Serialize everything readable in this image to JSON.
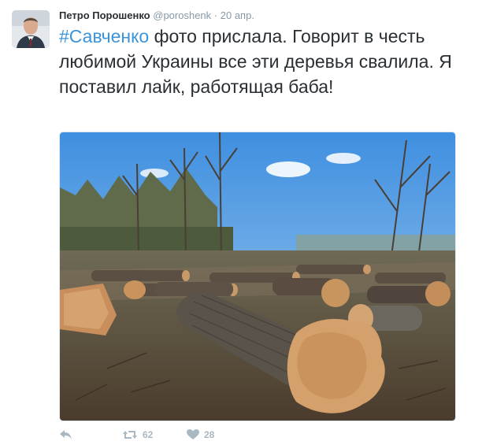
{
  "tweet": {
    "author_name": "Петро Порошенко",
    "handle": "@poroshenk",
    "separator": "·",
    "timestamp": "20 апр.",
    "hashtag": "#Савченко",
    "text_rest": " фото прислала. Говорит в честь любимой Украины все эти деревья свалила. Я поставил лайк, работящая баба!",
    "media_description_icon": "photo-of-felled-logs",
    "actions": {
      "reply_icon": "reply-icon",
      "retweet_icon": "retweet-icon",
      "retweet_count": "62",
      "like_icon": "heart-icon",
      "like_count": "28"
    },
    "colors": {
      "link": "#3b94d9",
      "muted": "#8899a6",
      "text": "#292f33",
      "action": "#aab8c2"
    }
  }
}
